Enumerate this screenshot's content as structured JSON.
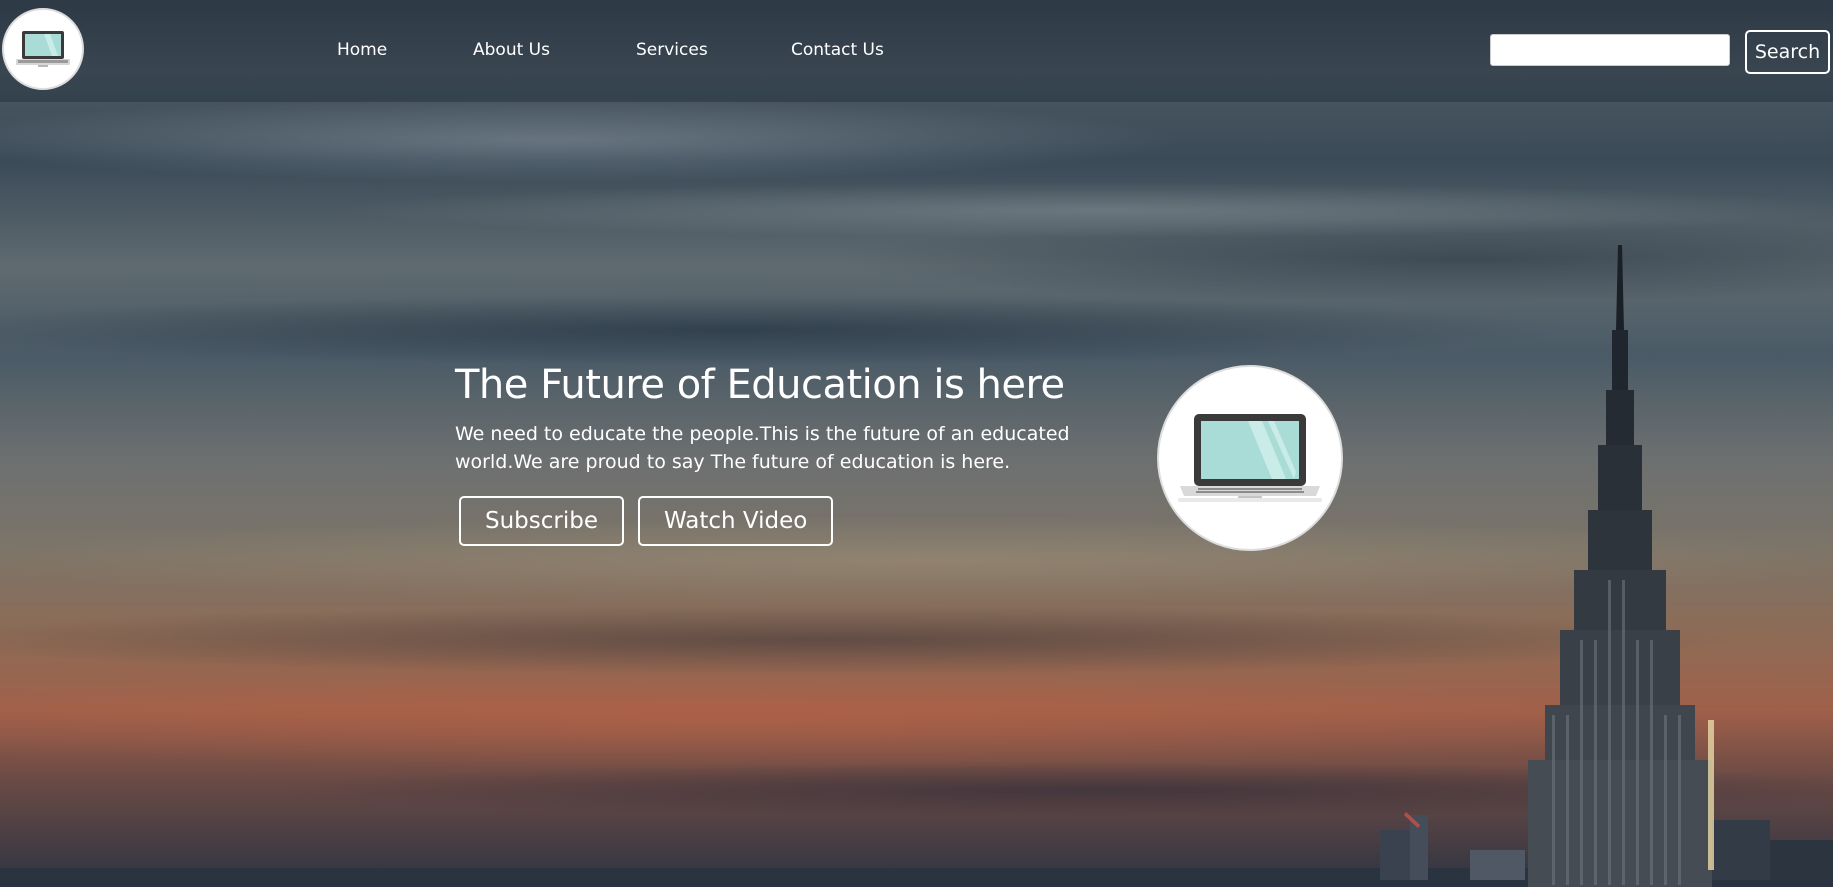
{
  "nav": {
    "logo_icon": "laptop-icon",
    "links": [
      {
        "label": "Home"
      },
      {
        "label": "About Us"
      },
      {
        "label": "Services"
      },
      {
        "label": "Contact Us"
      }
    ],
    "search": {
      "value": "",
      "placeholder": "",
      "button_label": "Search"
    }
  },
  "hero": {
    "title": "The Future of Education is here",
    "text": "We need to educate the people.This is the future of an educated world.We are proud to say The future of education is here.",
    "buttons": [
      {
        "label": "Subscribe"
      },
      {
        "label": "Watch Video"
      }
    ],
    "image_icon": "laptop-icon",
    "background": "city-skyline-sunset"
  },
  "colors": {
    "text": "#ffffff",
    "laptop_screen": "#a9dcd6",
    "laptop_frame": "#3a3a3a"
  }
}
